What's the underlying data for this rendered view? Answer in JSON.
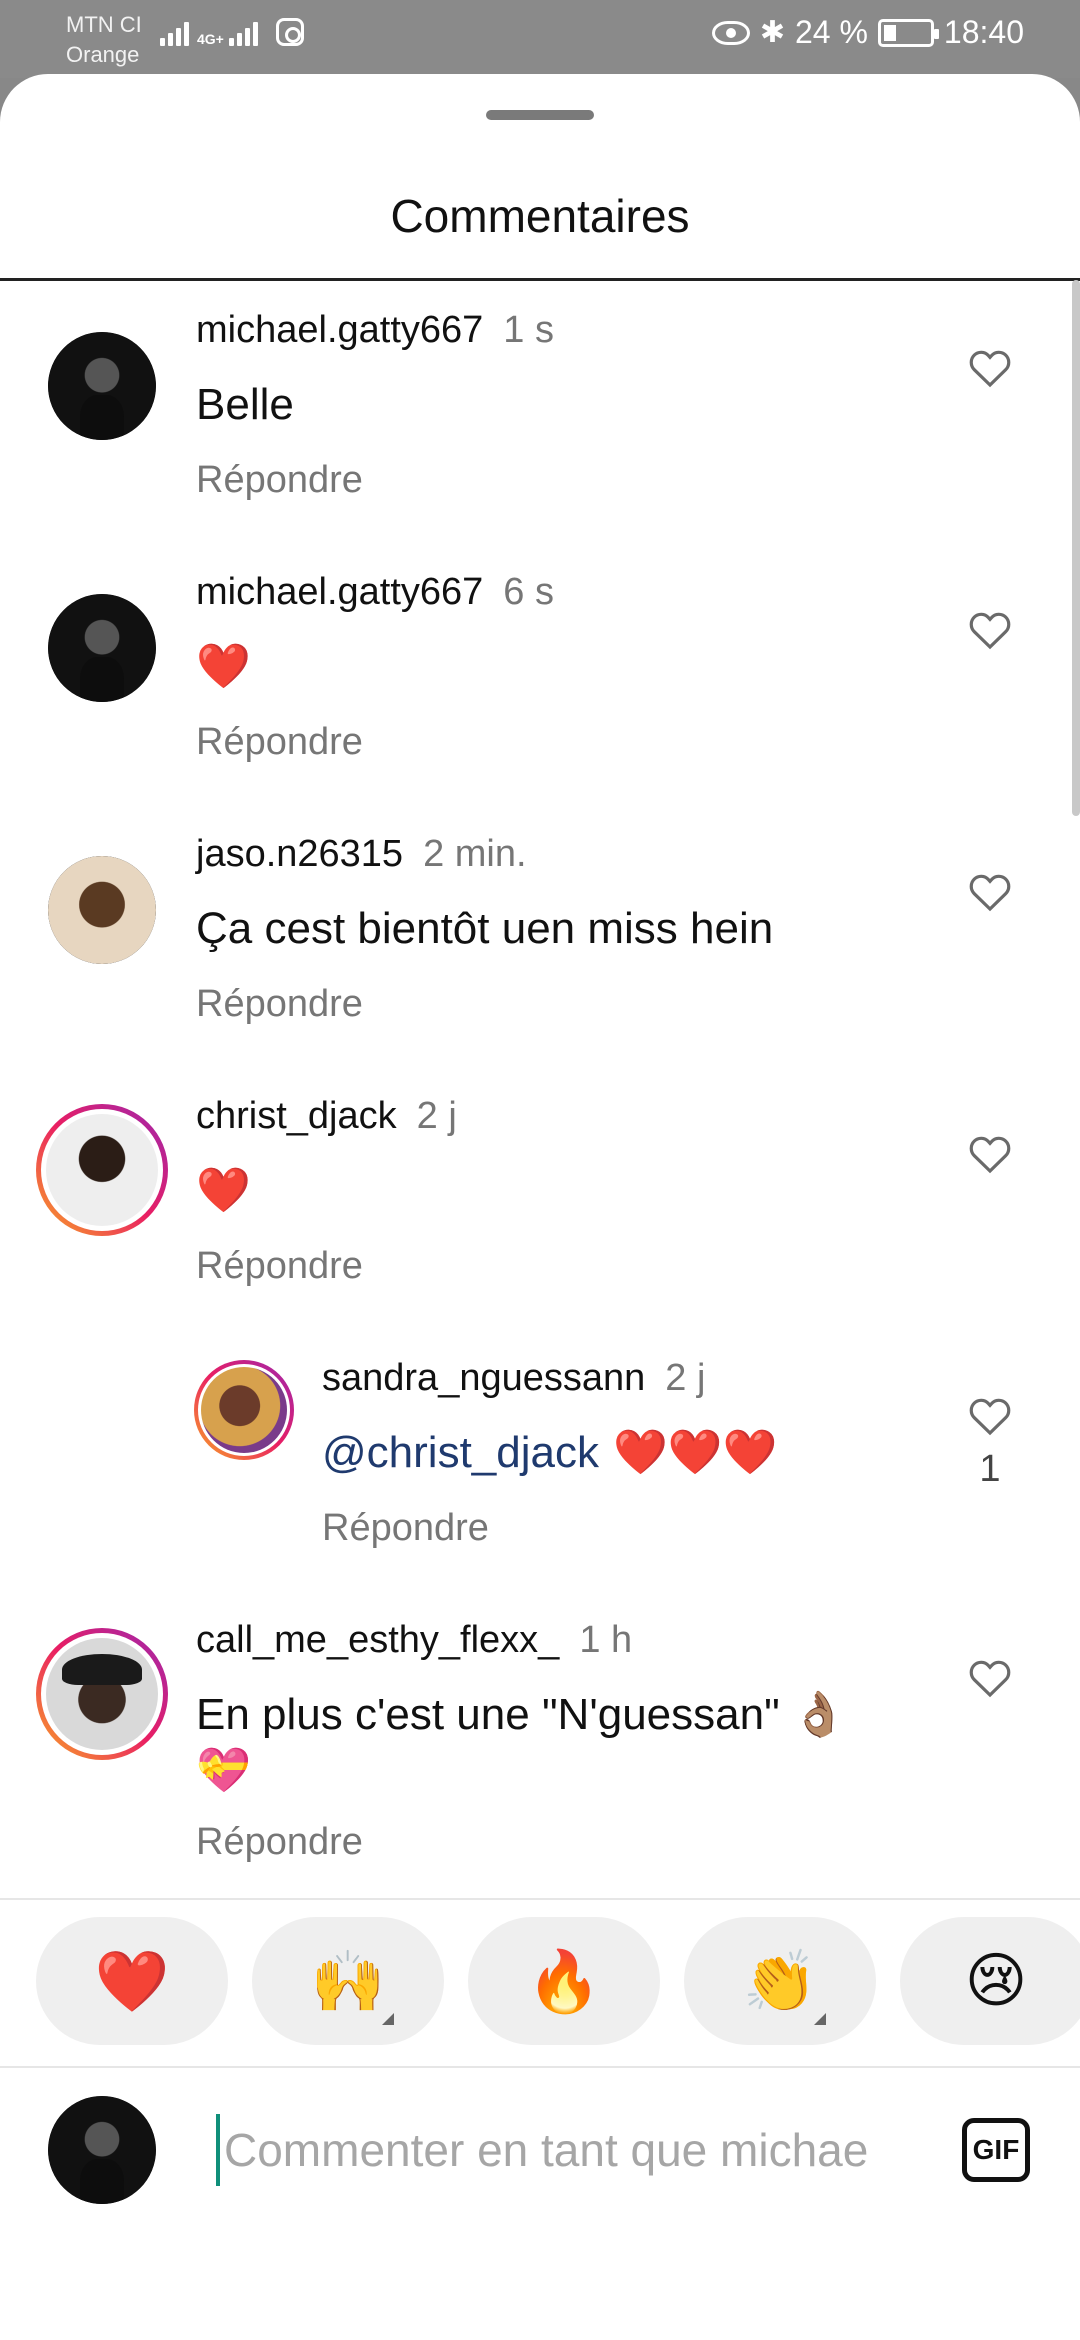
{
  "status_bar": {
    "carrier_line1": "MTN CI",
    "carrier_line2": "Orange",
    "network": "4G+",
    "battery": "24 %",
    "time": "18:40"
  },
  "sheet": {
    "title": "Commentaires"
  },
  "comments": [
    {
      "username": "michael.gatty667",
      "time": "1 s",
      "text": "Belle",
      "reply": "Répondre"
    },
    {
      "username": "michael.gatty667",
      "time": "6 s",
      "text": "❤️",
      "reply": "Répondre"
    },
    {
      "username": "jaso.n26315",
      "time": "2 min.",
      "text": "Ça  cest bientôt uen miss hein",
      "reply": "Répondre"
    },
    {
      "username": "christ_djack",
      "time": "2 j",
      "text": "❤️",
      "reply": "Répondre"
    },
    {
      "username": "sandra_nguessann",
      "time": "2 j",
      "mention": "@christ_djack",
      "text": " ❤️❤️❤️",
      "reply": "Répondre",
      "likes": "1"
    },
    {
      "username": "call_me_esthy_flexx_",
      "time": "1 h",
      "text": "En plus c'est une \"N'guessan\" 👌🏽",
      "text2": "💝",
      "reply": "Répondre"
    }
  ],
  "reactions": [
    "❤️",
    "🙌",
    "🔥",
    "👏",
    "😢"
  ],
  "composer": {
    "placeholder": "Commenter en tant que michae",
    "gif_label": "GIF"
  }
}
